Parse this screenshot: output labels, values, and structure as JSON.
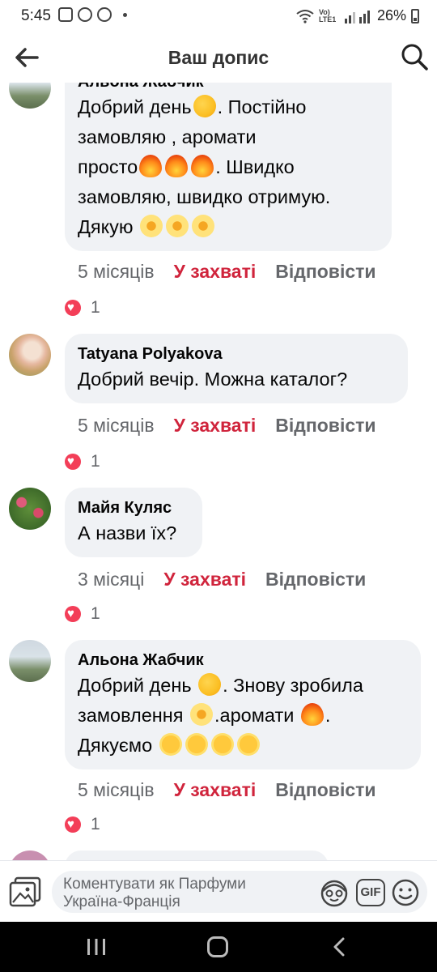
{
  "status_bar": {
    "time": "5:45",
    "network": "Vo) LTE1",
    "battery": "26%"
  },
  "header": {
    "title": "Ваш допис"
  },
  "comments": [
    {
      "author": "Альона Жабчик",
      "lines": [
        {
          "text": "Добрий день",
          "emoji_after": "hug",
          "tail": ". Постійно"
        },
        {
          "text": "замовляю , аромати"
        },
        {
          "text": "просто",
          "emoji_after": "fire-x3",
          "tail": ". Швидко"
        },
        {
          "text": "замовляю, швидко отримую."
        },
        {
          "text": "Дякую",
          "emoji_after": "daisy-x3"
        }
      ],
      "time": "5 місяців",
      "like_label": "У захваті",
      "reply_label": "Відповісти",
      "reaction_count": "1"
    },
    {
      "author": "Tatyana  Polyakova",
      "text": "Добрий вечір. Можна каталог?",
      "time": "5 місяців",
      "like_label": "У захваті",
      "reply_label": "Відповісти",
      "reaction_count": "1"
    },
    {
      "author": "Майя Куляс",
      "text": "А назви їх?",
      "time": "3 місяці",
      "like_label": "У захваті",
      "reply_label": "Відповісти",
      "reaction_count": "1"
    },
    {
      "author": "Альона Жабчик",
      "line1": "Добрий день",
      "line1_tail": ". Знову зробила",
      "line2": "замовлення",
      "line2_mid": ".аромати",
      "line2_tail": ".",
      "line3": "Дякуємо",
      "time": "5 місяців",
      "like_label": "У захваті",
      "reply_label": "Відповісти",
      "reaction_count": "1"
    }
  ],
  "composer": {
    "placeholder": "Коментувати як Парфуми Україна-Франція",
    "gif_label": "GIF"
  },
  "colors": {
    "like_red": "#d0243c",
    "bubble_bg": "#f0f2f5",
    "secondary_text": "#65676b",
    "heart": "#f33e58"
  }
}
